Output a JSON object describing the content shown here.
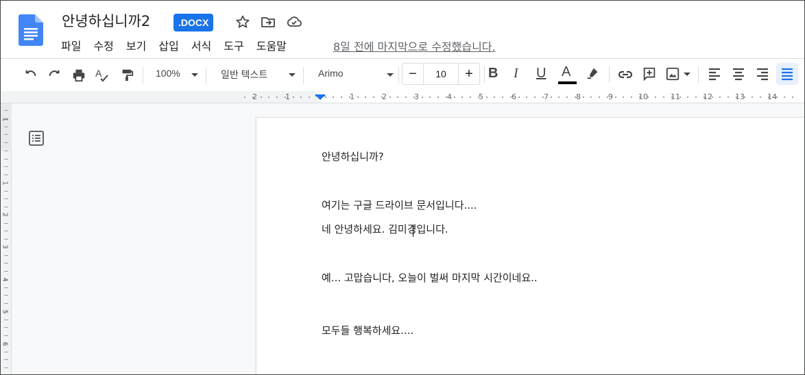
{
  "header": {
    "title": "안녕하십니까2",
    "badge": ".DOCX",
    "last_edit": "8일 전에 마지막으로 수정했습니다."
  },
  "menu": [
    "파일",
    "수정",
    "보기",
    "삽입",
    "서식",
    "도구",
    "도움말"
  ],
  "toolbar": {
    "zoom": "100%",
    "style": "일반 텍스트",
    "font": "Arimo",
    "font_size": "10",
    "decrease": "−",
    "increase": "+",
    "bold": "B",
    "italic": "I",
    "underline": "U",
    "text_color": "A"
  },
  "ruler": {
    "numbers": [
      "2",
      "1",
      "1",
      "2",
      "3",
      "4",
      "5",
      "6",
      "7",
      "8",
      "9",
      "10",
      "11",
      "12",
      "13",
      "14"
    ],
    "vertical_numbers": [
      "1",
      "1",
      "2",
      "3",
      "4",
      "5",
      "6"
    ]
  },
  "document": {
    "lines": [
      "안녕하십니까?",
      "여기는 구글 드라이브 문서입니다....",
      "네 안녕하세요.  김미경입니다.",
      "예... 고맙습니다, 오늘이 벌써 마지막 시간이네요..",
      "모두들 행복하세요...."
    ]
  },
  "colors": {
    "accent": "#1a73e8",
    "text_color_bar": "#000000",
    "active_button_bg": "#e8f0fe"
  }
}
